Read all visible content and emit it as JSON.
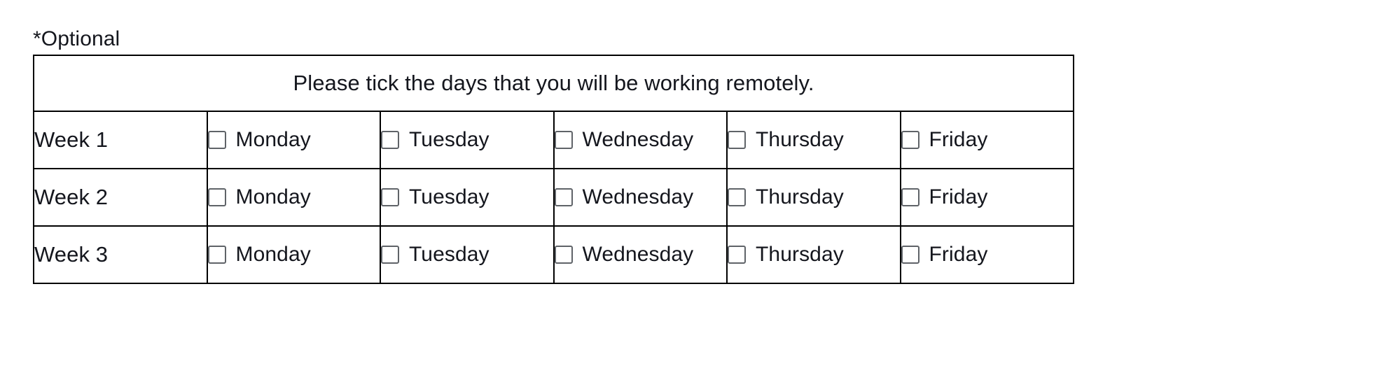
{
  "optional_note": "*Optional",
  "table": {
    "header": "Please tick the days that you will be working remotely.",
    "columns": [
      "",
      "Monday",
      "Tuesday",
      "Wednesday",
      "Thursday",
      "Friday"
    ],
    "rows": [
      {
        "week_label": "Week 1",
        "days": [
          {
            "label": "Monday",
            "checked": false
          },
          {
            "label": "Tuesday",
            "checked": false
          },
          {
            "label": "Wednesday",
            "checked": false
          },
          {
            "label": "Thursday",
            "checked": false
          },
          {
            "label": "Friday",
            "checked": false
          }
        ]
      },
      {
        "week_label": "Week 2",
        "days": [
          {
            "label": "Monday",
            "checked": false
          },
          {
            "label": "Tuesday",
            "checked": false
          },
          {
            "label": "Wednesday",
            "checked": false
          },
          {
            "label": "Thursday",
            "checked": false
          },
          {
            "label": "Friday",
            "checked": false
          }
        ]
      },
      {
        "week_label": "Week 3",
        "days": [
          {
            "label": "Monday",
            "checked": false
          },
          {
            "label": "Tuesday",
            "checked": false
          },
          {
            "label": "Wednesday",
            "checked": false
          },
          {
            "label": "Thursday",
            "checked": false
          },
          {
            "label": "Friday",
            "checked": false
          }
        ]
      }
    ]
  },
  "colors": {
    "text": "#14161d",
    "border": "#000000",
    "checkbox_border": "#5f6368",
    "background": "#ffffff"
  }
}
